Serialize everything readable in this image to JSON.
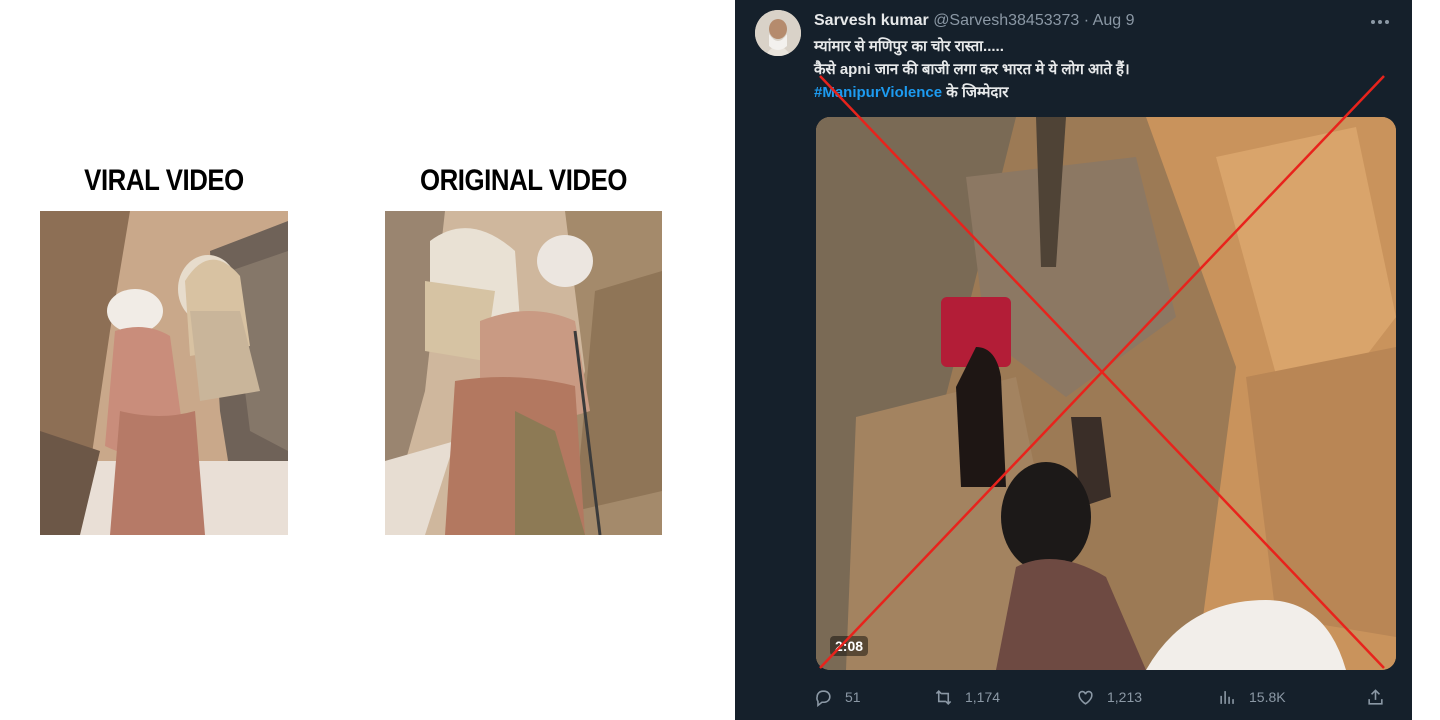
{
  "comparison": {
    "viral_label": "VIRAL VIDEO",
    "original_label": "ORIGINAL VIDEO"
  },
  "tweet": {
    "author_name": "Sarvesh kumar",
    "author_handle": "@Sarvesh38453373",
    "separator": "·",
    "date": "Aug 9",
    "more_icon": "more-horizontal-icon",
    "text_line1": "म्यांमार से मणिपुर का चोर रास्ता.....",
    "text_line2": "कैसे apni जान की बाजी लगा कर भारत मे ये लोग आते हैं।",
    "hashtag": "#ManipurViolence",
    "text_line3_rest": " के जिम्मेदार",
    "video_duration": "2:08",
    "replies": "51",
    "retweets": "1,174",
    "likes": "1,213",
    "views": "15.8K"
  },
  "colors": {
    "tweet_background": "#15202b",
    "link_blue": "#1d9bf0",
    "muted_text": "#8b98a5",
    "cross_red": "#e8231c"
  }
}
